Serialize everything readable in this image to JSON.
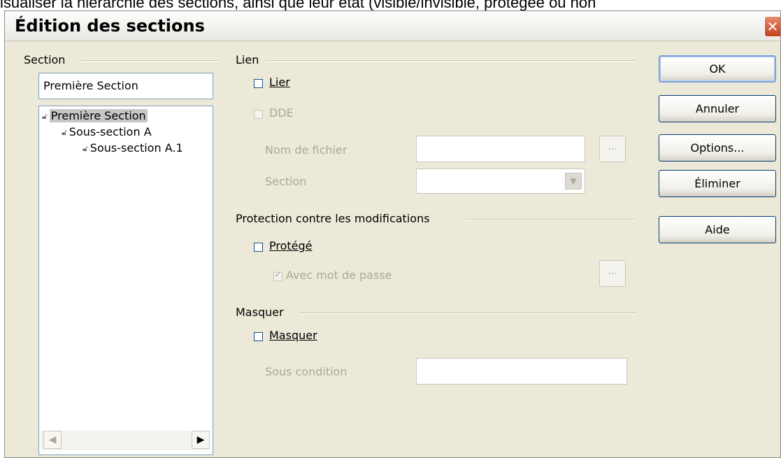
{
  "caption": "isualiser la hiérarchie des sections, ainsi que leur état (visible/invisible, protégée ou non",
  "window": {
    "title": "Édition des sections",
    "close_glyph": "✕"
  },
  "section_group": {
    "label": "Section",
    "name_value": "Première Section",
    "tree": [
      {
        "label": "Première Section",
        "selected": true
      },
      {
        "label": "Sous-section A"
      },
      {
        "label": "Sous-section A.1"
      }
    ],
    "scroll_left": "◀",
    "scroll_right": "▶"
  },
  "lien_group": {
    "label": "Lien",
    "lier_label": "Lier",
    "dde_label": "DDE",
    "filename_label": "Nom de fichier",
    "filename_value": "",
    "browse_label": "...",
    "section_label": "Section",
    "section_value": "",
    "dropdown_glyph": "▼"
  },
  "protection_group": {
    "label": "Protection contre les modifications",
    "protege_label": "Protégé",
    "password_label": "Avec mot de passe",
    "password_button": "..."
  },
  "masquer_group": {
    "label": "Masquer",
    "masquer_label": "Masquer",
    "condition_label": "Sous condition",
    "condition_value": ""
  },
  "buttons": {
    "ok": "OK",
    "cancel": "Annuler",
    "options": "Options...",
    "delete": "Éliminer",
    "help": "Aide"
  },
  "icons": {
    "lock": "lock-icon"
  },
  "colors": {
    "dialog_bg": "#ece9d8",
    "close_red": "#c3411c",
    "disabled_text": "#aca899"
  }
}
